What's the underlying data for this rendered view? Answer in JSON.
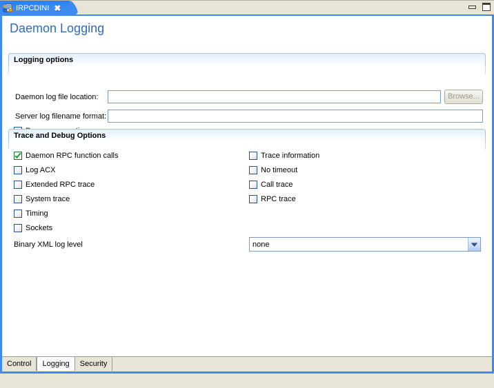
{
  "window": {
    "tab": {
      "label": "IRPCDINI",
      "close_label": "✖",
      "icon": "file-config-icon"
    },
    "controls": {
      "minimize_label": "Minimize",
      "maximize_label": "Maximize"
    }
  },
  "form": {
    "title": "Daemon Logging"
  },
  "logging_options": {
    "section_title": "Logging options",
    "daemon_log_file_label": "Daemon log file location:",
    "daemon_log_file_value": "",
    "daemon_log_file_placeholder": "",
    "browse_label": "Browse...",
    "server_log_format_label": "Server log filename format:",
    "server_log_format_value": "",
    "server_log_format_placeholder": "",
    "daemon_operations_label": "Daemon operations",
    "daemon_operations_checked": false
  },
  "trace_debug_options": {
    "section_title": "Trace and Debug Options",
    "left_column": [
      {
        "label": "Daemon RPC function calls",
        "checked": true
      },
      {
        "label": "Log ACX",
        "checked": false
      },
      {
        "label": "Extended RPC trace",
        "checked": false
      },
      {
        "label": "System trace",
        "checked": false
      },
      {
        "label": "Timing",
        "checked": false
      },
      {
        "label": "Sockets",
        "checked": false
      }
    ],
    "right_column": [
      {
        "label": "Trace information",
        "checked": false
      },
      {
        "label": "No timeout",
        "checked": false
      },
      {
        "label": "Call trace",
        "checked": false
      },
      {
        "label": "RPC trace",
        "checked": false
      }
    ],
    "binary_xml_label": "Binary XML log level",
    "binary_xml_value": "none"
  },
  "bottom_tabs": [
    {
      "label": "Control",
      "active": false
    },
    {
      "label": "Logging",
      "active": true
    },
    {
      "label": "Security",
      "active": false
    }
  ],
  "colors": {
    "tab_active_blue": "#3d8bf2",
    "title_text": "#2f6bbd",
    "section_border": "#a8c5e8",
    "field_border": "#7a9cbf",
    "chrome_beige": "#e8e4d6",
    "check_green": "#1d9b2b"
  }
}
